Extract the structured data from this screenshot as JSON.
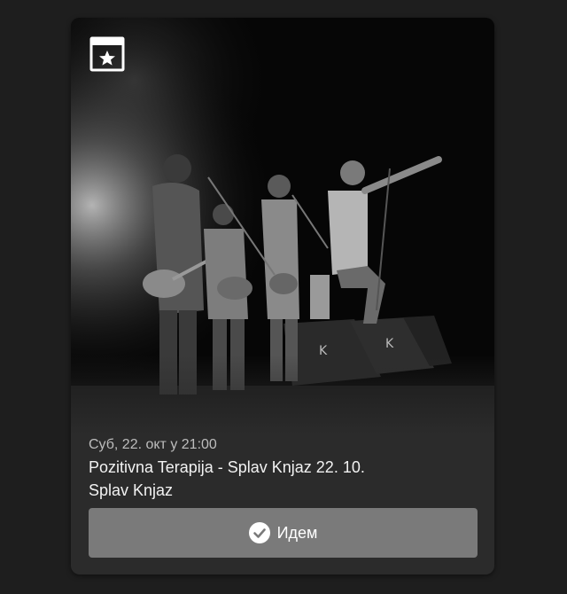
{
  "event": {
    "date": "Суб, 22. окт у 21:00",
    "title": "Pozitivna Terapija - Splav Knjaz 22. 10.",
    "venue": "Splav Knjaz"
  },
  "actions": {
    "going_label": "Идем"
  },
  "icons": {
    "calendar": "calendar-star-icon",
    "check": "check-circle-icon"
  },
  "colors": {
    "background": "#1e1e1e",
    "card": "#2b2b2b",
    "button": "#7a7a7a"
  }
}
